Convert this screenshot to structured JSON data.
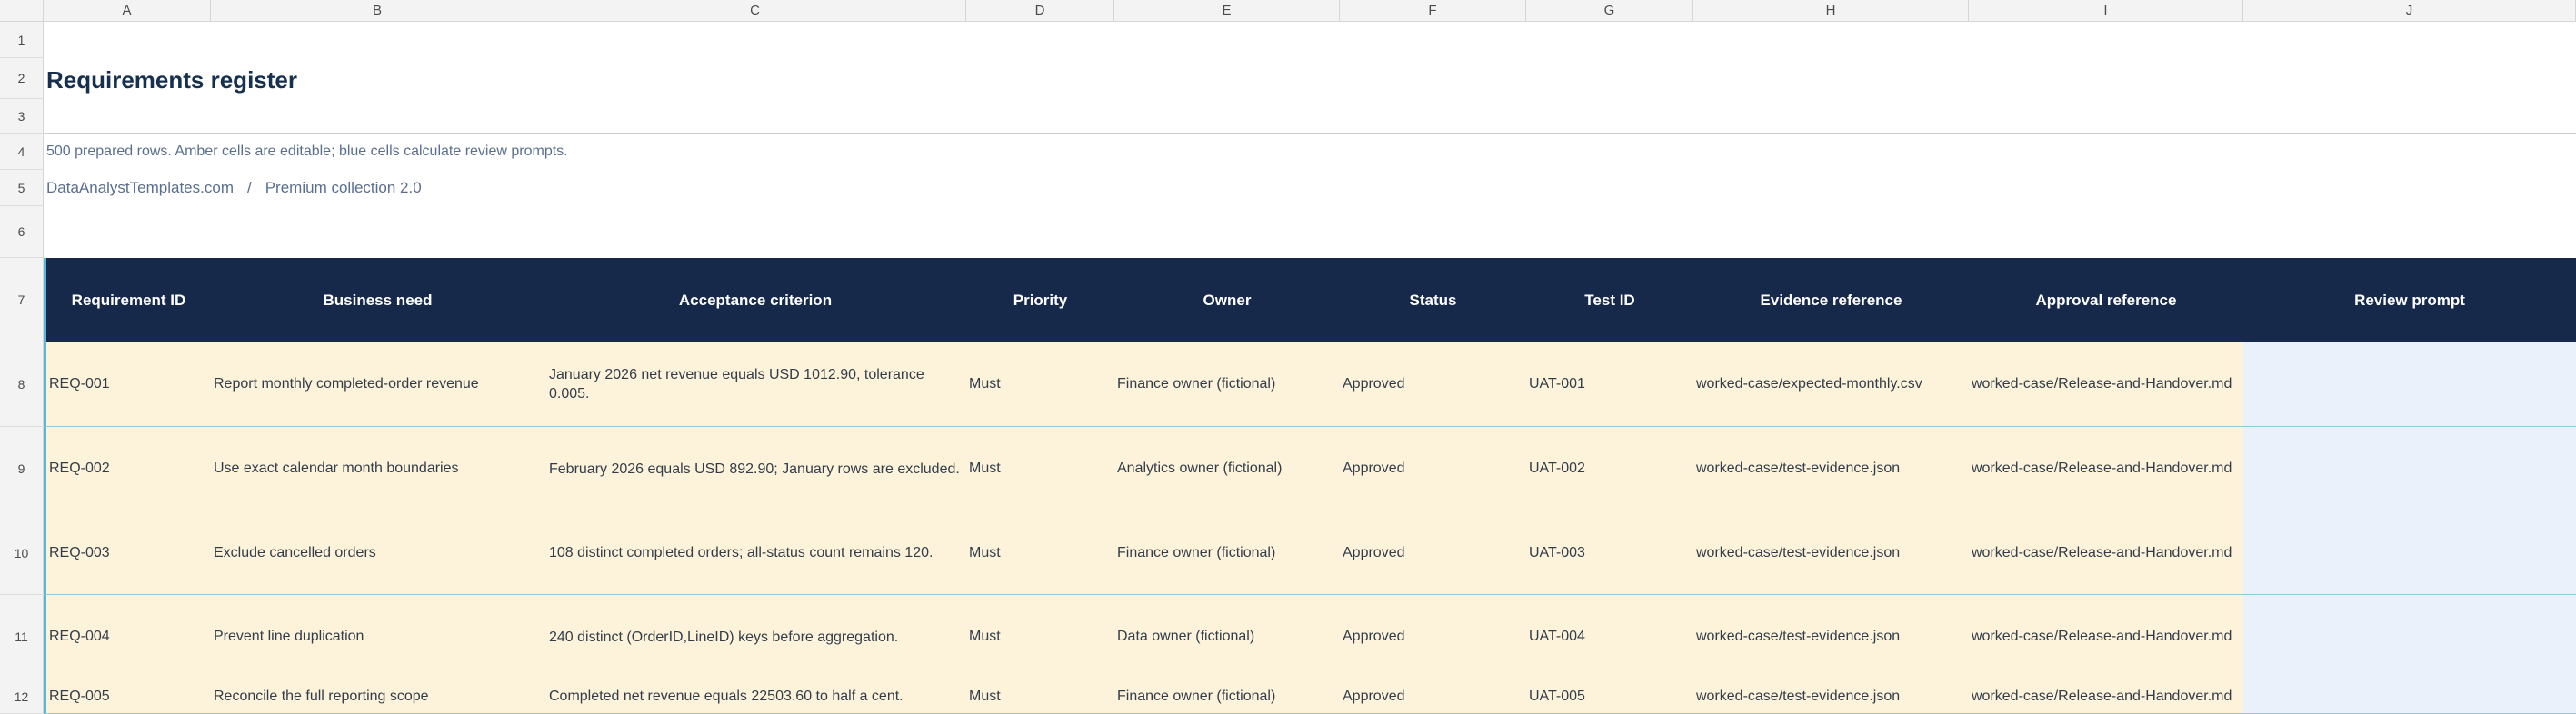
{
  "columns": [
    "A",
    "B",
    "C",
    "D",
    "E",
    "F",
    "G",
    "H",
    "I",
    "J"
  ],
  "row_numbers": [
    "1",
    "2",
    "3",
    "4",
    "5",
    "6",
    "7",
    "8",
    "9",
    "10",
    "11",
    "12"
  ],
  "title": "Requirements register",
  "note": "500 prepared rows. Amber cells are editable; blue cells calculate review prompts.",
  "breadcrumb": {
    "site": "DataAnalystTemplates.com",
    "separator": "/",
    "collection": "Premium collection 2.0"
  },
  "table": {
    "headers": [
      "Requirement ID",
      "Business need",
      "Acceptance criterion",
      "Priority",
      "Owner",
      "Status",
      "Test ID",
      "Evidence reference",
      "Approval reference",
      "Review prompt"
    ],
    "rows": [
      {
        "id": "REQ-001",
        "need": "Report monthly completed-order revenue",
        "criterion": "January 2026 net revenue equals USD 1012.90, tolerance 0.005.",
        "priority": "Must",
        "owner": "Finance owner (fictional)",
        "status": "Approved",
        "test": "UAT-001",
        "evidence": "worked-case/expected-monthly.csv",
        "approval": "worked-case/Release-and-Handover.md",
        "review": ""
      },
      {
        "id": "REQ-002",
        "need": "Use exact calendar month boundaries",
        "criterion": "February 2026 equals USD 892.90; January rows are excluded.",
        "priority": "Must",
        "owner": "Analytics owner (fictional)",
        "status": "Approved",
        "test": "UAT-002",
        "evidence": "worked-case/test-evidence.json",
        "approval": "worked-case/Release-and-Handover.md",
        "review": ""
      },
      {
        "id": "REQ-003",
        "need": "Exclude cancelled orders",
        "criterion": "108 distinct completed orders; all-status count remains 120.",
        "priority": "Must",
        "owner": "Finance owner (fictional)",
        "status": "Approved",
        "test": "UAT-003",
        "evidence": "worked-case/test-evidence.json",
        "approval": "worked-case/Release-and-Handover.md",
        "review": ""
      },
      {
        "id": "REQ-004",
        "need": "Prevent line duplication",
        "criterion": "240 distinct (OrderID,LineID) keys before aggregation.",
        "priority": "Must",
        "owner": "Data owner (fictional)",
        "status": "Approved",
        "test": "UAT-004",
        "evidence": "worked-case/test-evidence.json",
        "approval": "worked-case/Release-and-Handover.md",
        "review": ""
      },
      {
        "id": "REQ-005",
        "need": "Reconcile the full reporting scope",
        "criterion": "Completed net revenue equals 22503.60 to half a cent.",
        "priority": "Must",
        "owner": "Finance owner (fictional)",
        "status": "Approved",
        "test": "UAT-005",
        "evidence": "worked-case/test-evidence.json",
        "approval": "worked-case/Release-and-Handover.md",
        "review": ""
      }
    ]
  },
  "colors": {
    "header_bg": "#16294a",
    "editable_fill": "#fdf3db",
    "calculated_fill": "#eaf1fb",
    "accent": "#55b8d6",
    "title": "#17304f"
  },
  "icons": {
    "dropdown": "dropdown-arrow-icon"
  }
}
